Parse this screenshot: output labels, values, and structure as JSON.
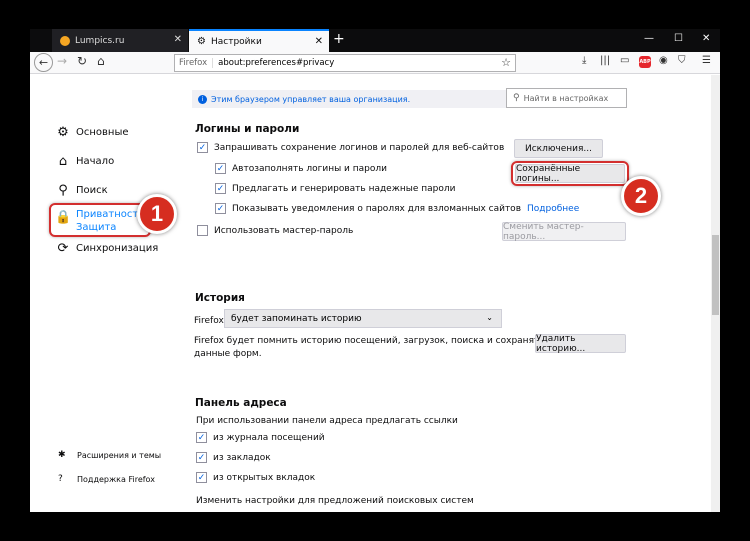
{
  "tabs": [
    {
      "label": "Lumpics.ru",
      "color": "#f5a623"
    },
    {
      "label": "Настройки"
    }
  ],
  "url": {
    "identity": "Firefox",
    "address": "about:preferences#privacy"
  },
  "banner": "Этим браузером управляет ваша организация.",
  "search_placeholder": "Найти в настройках",
  "sidebar": {
    "items": [
      {
        "label": "Основные",
        "icon": "gear-icon"
      },
      {
        "label": "Начало",
        "icon": "home-icon"
      },
      {
        "label": "Поиск",
        "icon": "search-icon"
      },
      {
        "label_line1": "Приватность и",
        "label_line2": "Защита",
        "icon": "lock-icon"
      },
      {
        "label": "Синхронизация",
        "icon": "sync-icon"
      }
    ],
    "bottom": [
      {
        "label": "Расширения и темы",
        "icon": "puzzle-icon"
      },
      {
        "label": "Поддержка Firefox",
        "icon": "help-icon"
      }
    ]
  },
  "logins": {
    "title": "Логины и пароли",
    "ask_save": "Запрашивать сохранение логинов и паролей для веб-сайтов",
    "autofill": "Автозаполнять логины и пароли",
    "suggest": "Предлагать и генерировать надежные пароли",
    "alerts": "Показывать уведомления о паролях для взломанных сайтов",
    "learn_more": "Подробнее",
    "master": "Использовать мастер-пароль",
    "exceptions_btn": "Исключения...",
    "saved_btn": "Сохранённые логины...",
    "change_master_btn": "Сменить мастер-пароль..."
  },
  "history": {
    "title": "История",
    "firefox_label": "Firefox",
    "select_value": "будет запоминать историю",
    "desc_line1": "Firefox будет помнить историю посещений, загрузок, поиска и сохранять",
    "desc_line2": "данные форм.",
    "clear_btn": "Удалить историю..."
  },
  "address_bar": {
    "title": "Панель адреса",
    "desc": "При использовании панели адреса предлагать ссылки",
    "opt1": "из журнала посещений",
    "opt2": "из закладок",
    "opt3": "из открытых вкладок",
    "change_link": "Изменить настройки для предложений поисковых систем"
  },
  "badges": {
    "one": "1",
    "two": "2"
  },
  "colors": {
    "accent": "#0a84ff",
    "highlight": "#d32f2f",
    "badge": "#d62d20"
  }
}
